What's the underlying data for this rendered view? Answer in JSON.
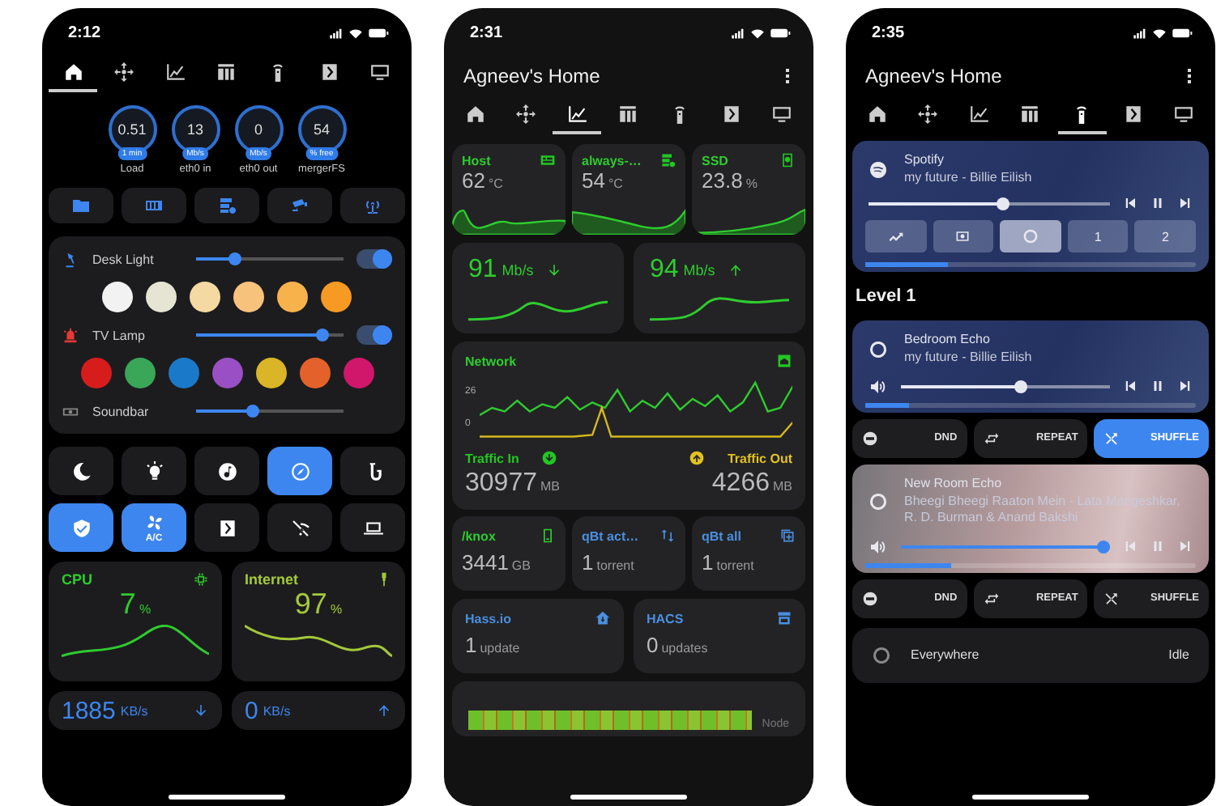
{
  "dashboard_screen": {
    "status_time": "2:12",
    "tabs": [
      {
        "selected": true
      },
      {
        "selected": false
      },
      {
        "selected": false
      },
      {
        "selected": false
      },
      {
        "selected": false
      },
      {
        "selected": false
      },
      {
        "selected": false
      }
    ],
    "gauges": [
      {
        "value": "0.51",
        "unit": "1 min",
        "label": "Load"
      },
      {
        "value": "13",
        "unit": "Mb/s",
        "label": "eth0 in"
      },
      {
        "value": "0",
        "unit": "Mb/s",
        "label": "eth0 out"
      },
      {
        "value": "54",
        "unit": "% free",
        "label": "mergerFS"
      }
    ],
    "lights": [
      {
        "kind": "light",
        "name": "Desk Light",
        "level": 0.26,
        "on": true,
        "swatches": [
          {
            "color": "#f2f2f2"
          },
          {
            "color": "#e6e4d2"
          },
          {
            "color": "#f5d9a2"
          },
          {
            "color": "#f7c27c"
          },
          {
            "color": "#f8b24c"
          },
          {
            "color": "#f79a24"
          }
        ]
      },
      {
        "kind": "light",
        "name": "TV Lamp",
        "level": 0.86,
        "on": true,
        "swatches": [
          {
            "color": "#d71c1c"
          },
          {
            "color": "#3aa657"
          },
          {
            "color": "#1b79c9"
          },
          {
            "color": "#9a4fc4"
          },
          {
            "color": "#d9b527"
          },
          {
            "color": "#e4612b"
          },
          {
            "color": "#d0176c"
          }
        ]
      },
      {
        "kind": "media",
        "name": "Soundbar",
        "level": 0.39
      }
    ],
    "toggles": [
      {
        "selected": false
      },
      {
        "selected": false
      },
      {
        "selected": false
      },
      {
        "selected": true
      },
      {
        "selected": false
      },
      {
        "selected": true
      },
      {
        "selected": true,
        "label": "A/C"
      },
      {
        "selected": false
      },
      {
        "selected": false
      },
      {
        "selected": false
      }
    ],
    "sensors": [
      {
        "title": "CPU",
        "value": "7",
        "unit": "%",
        "color": "#2ecc2e"
      },
      {
        "title": "Internet",
        "value": "97",
        "unit": "%",
        "color": "#a3c83a"
      }
    ],
    "speeds": [
      {
        "value": "1885",
        "unit": "KB/s"
      },
      {
        "value": "0",
        "unit": "KB/s"
      }
    ]
  },
  "stats_screen": {
    "status_time": "2:31",
    "title": "Agneev's Home",
    "tabs": [
      {
        "selected": false
      },
      {
        "selected": false
      },
      {
        "selected": true
      },
      {
        "selected": false
      },
      {
        "selected": false
      },
      {
        "selected": false
      },
      {
        "selected": false
      }
    ],
    "temps": [
      {
        "title": "Host",
        "value": "62",
        "unit": "°C"
      },
      {
        "title": "always-…",
        "value": "54",
        "unit": "°C"
      },
      {
        "title": "SSD",
        "value": "23.8",
        "unit": "%"
      }
    ],
    "speeds": [
      {
        "value": "91",
        "unit": "Mb/s"
      },
      {
        "value": "94",
        "unit": "Mb/s"
      }
    ],
    "network": {
      "title": "Network",
      "axis_labels": [
        "26",
        "0"
      ],
      "traffic": [
        {
          "label": "Traffic In",
          "value": "30977",
          "unit": "MB",
          "color": "#22c722"
        },
        {
          "label": "Traffic Out",
          "value": "4266",
          "unit": "MB",
          "color": "#e2c21c"
        }
      ]
    },
    "storage": [
      {
        "title": "/knox",
        "value": "3441",
        "unit": "GB",
        "color": "#2ecc2e"
      },
      {
        "title": "qBt act…",
        "value": "1",
        "unit": "torrent",
        "color": "#4a8fe0"
      },
      {
        "title": "qBt all",
        "value": "1",
        "unit": "torrent",
        "color": "#4a8fe0"
      }
    ],
    "updates": [
      {
        "title": "Hass.io",
        "value": "1",
        "unit": "update"
      },
      {
        "title": "HACS",
        "value": "0",
        "unit": "updates"
      }
    ],
    "node": {
      "label": "Node"
    }
  },
  "media_screen": {
    "status_time": "2:35",
    "title": "Agneev's Home",
    "tabs": [
      {
        "selected": false
      },
      {
        "selected": false
      },
      {
        "selected": false
      },
      {
        "selected": false
      },
      {
        "selected": true
      },
      {
        "selected": false
      },
      {
        "selected": false
      }
    ],
    "group_player": {
      "name": "Spotify",
      "track": "my future - Billie Eilish",
      "volume": {
        "level": 0.56
      },
      "progress": {
        "level": 0.25
      },
      "sources": [
        {
          "selected": false
        },
        {
          "selected": false
        },
        {
          "selected": true
        },
        {
          "selected": false,
          "label": "1"
        },
        {
          "selected": false,
          "label": "2"
        }
      ]
    },
    "section": "Level 1",
    "rooms": [
      {
        "name": "Bedroom Echo",
        "track": "my future - Billie Eilish",
        "volume": {
          "level": 0.57
        },
        "progress": {
          "level": 0.13
        },
        "actions": [
          {
            "label": "DND",
            "selected": false
          },
          {
            "label": "REPEAT",
            "selected": false
          },
          {
            "label": "SHUFFLE",
            "selected": true
          }
        ]
      },
      {
        "name": "New Room Echo",
        "track": "Bheegi Bheegi Raaton Mein - Lata Mangeshkar, R. D. Burman & Anand Bakshi",
        "volume": {
          "level": 0.97
        },
        "progress": {
          "level": 0.26
        },
        "actions": [
          {
            "label": "DND",
            "selected": false
          },
          {
            "label": "REPEAT",
            "selected": false
          },
          {
            "label": "SHUFFLE",
            "selected": false
          }
        ]
      }
    ],
    "idle": {
      "name": "Everywhere",
      "status": "Idle"
    }
  }
}
